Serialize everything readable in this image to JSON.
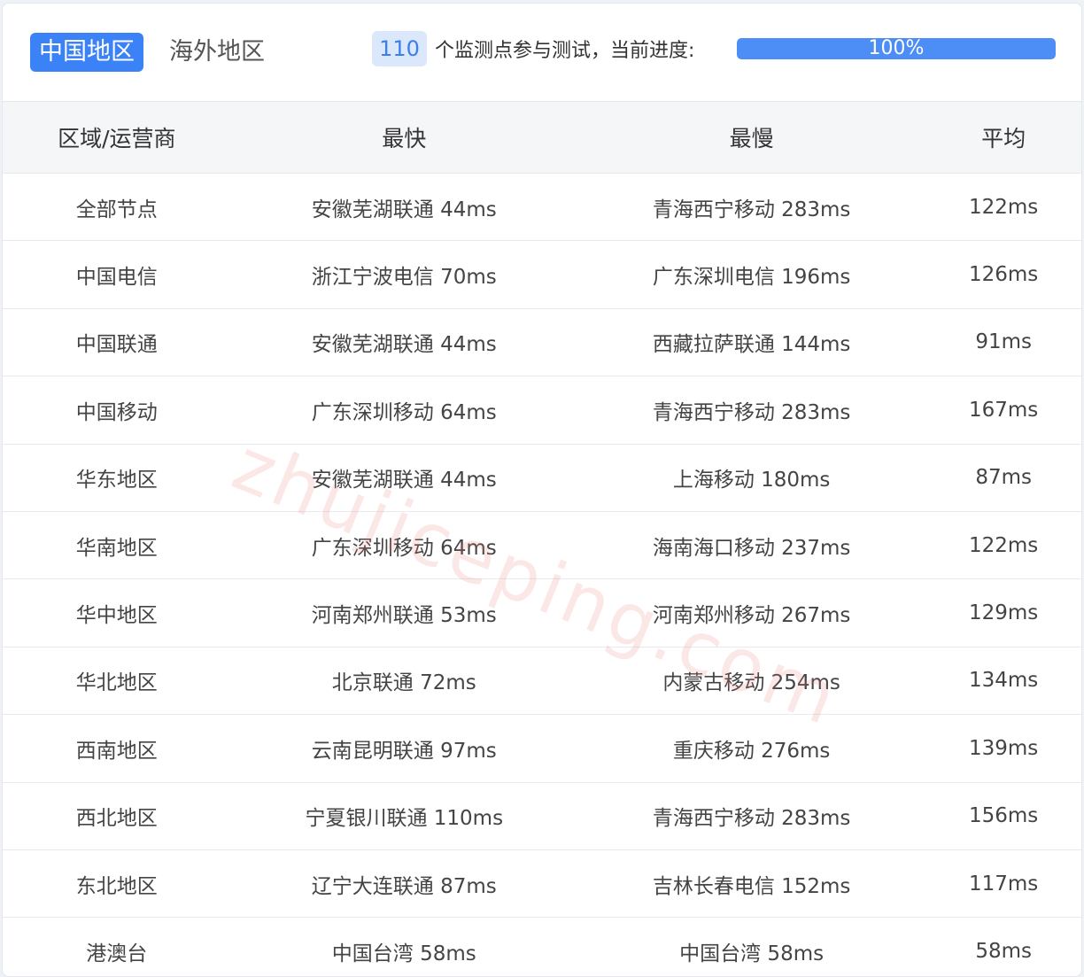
{
  "tabs": {
    "domestic": "中国地区",
    "overseas": "海外地区"
  },
  "progress": {
    "nodes": "110",
    "text": "个监测点参与测试，当前进度:",
    "percent_label": "100%",
    "percent": 1.0
  },
  "columns": [
    "区域/运营商",
    "最快",
    "最慢",
    "平均"
  ],
  "rows": [
    [
      "全部节点",
      "安徽芜湖联通 44ms",
      "青海西宁移动 283ms",
      "122ms"
    ],
    [
      "中国电信",
      "浙江宁波电信 70ms",
      "广东深圳电信 196ms",
      "126ms"
    ],
    [
      "中国联通",
      "安徽芜湖联通 44ms",
      "西藏拉萨联通 144ms",
      "91ms"
    ],
    [
      "中国移动",
      "广东深圳移动 64ms",
      "青海西宁移动 283ms",
      "167ms"
    ],
    [
      "华东地区",
      "安徽芜湖联通 44ms",
      "上海移动 180ms",
      "87ms"
    ],
    [
      "华南地区",
      "广东深圳移动 64ms",
      "海南海口移动 237ms",
      "122ms"
    ],
    [
      "华中地区",
      "河南郑州联通 53ms",
      "河南郑州移动 267ms",
      "129ms"
    ],
    [
      "华北地区",
      "北京联通 72ms",
      "内蒙古移动 254ms",
      "134ms"
    ],
    [
      "西南地区",
      "云南昆明联通 97ms",
      "重庆移动 276ms",
      "139ms"
    ],
    [
      "西北地区",
      "宁夏银川联通 110ms",
      "青海西宁移动 283ms",
      "156ms"
    ],
    [
      "东北地区",
      "辽宁大连联通 87ms",
      "吉林长春电信 152ms",
      "117ms"
    ],
    [
      "港澳台",
      "中国台湾 58ms",
      "中国台湾 58ms",
      "58ms"
    ]
  ],
  "watermark": "zhujiceping.com",
  "colors": {
    "accent": "#3b82f6",
    "badge_bg": "#dbe8fb",
    "header_bg": "#f5f6f8"
  }
}
